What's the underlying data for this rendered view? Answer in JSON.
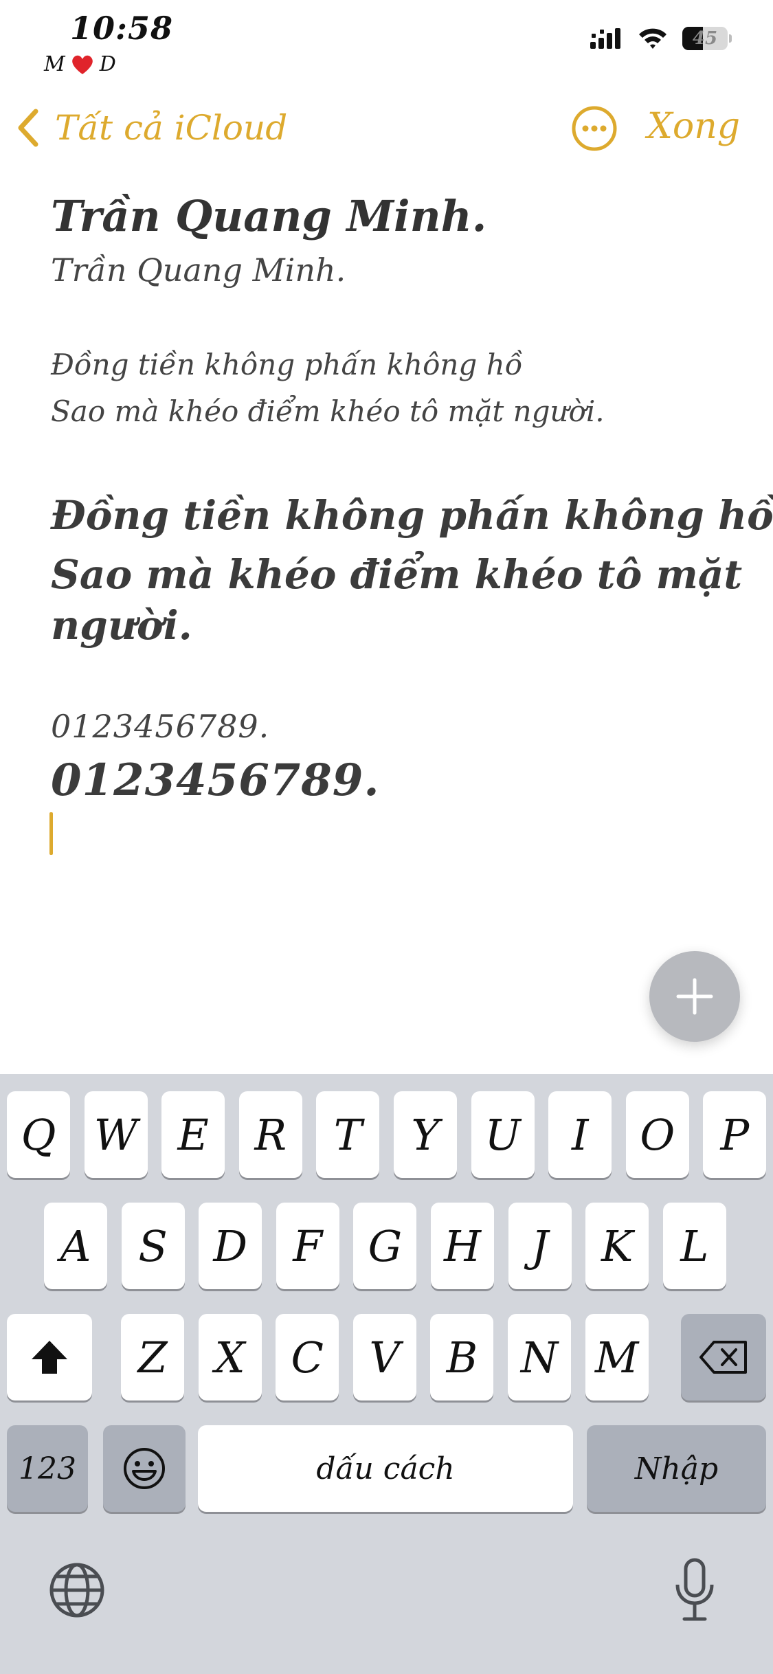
{
  "status_bar": {
    "time": "10:58",
    "carrier_left": "M",
    "carrier_right": "D",
    "battery_percent": "45",
    "battery_level": 0.45
  },
  "nav": {
    "back_label": "Tất cả iCloud",
    "more_icon": "ellipsis-circle-icon",
    "done_label": "Xong"
  },
  "note": {
    "title": "Trần Quang Minh.",
    "subtitle": "Trần Quang Minh.",
    "poem_small_line1": "Đồng tiền không phấn không hồ",
    "poem_small_line2": "Sao mà khéo điểm khéo tô mặt người.",
    "poem_big_line1": "Đồng tiền không phấn không hồ",
    "poem_big_line2": "Sao mà khéo điểm khéo tô mặt",
    "poem_big_line3": "người.",
    "digits_small": "0123456789.",
    "digits_big": "0123456789."
  },
  "fab": {
    "icon": "plus-icon"
  },
  "keyboard": {
    "row1": [
      "Q",
      "W",
      "E",
      "R",
      "T",
      "Y",
      "U",
      "I",
      "O",
      "P"
    ],
    "row2": [
      "A",
      "S",
      "D",
      "F",
      "G",
      "H",
      "J",
      "K",
      "L"
    ],
    "row3": [
      "Z",
      "X",
      "C",
      "V",
      "B",
      "N",
      "M"
    ],
    "numbers_label": "123",
    "space_label": "dấu cách",
    "return_label": "Nhập",
    "icons": [
      "shift-icon",
      "delete-icon",
      "emoji-icon",
      "globe-icon",
      "microphone-icon"
    ]
  },
  "colors": {
    "accent": "#DDAA2E",
    "keyboard_bg": "#d3d6dc",
    "key_dark": "#abb0ba"
  }
}
